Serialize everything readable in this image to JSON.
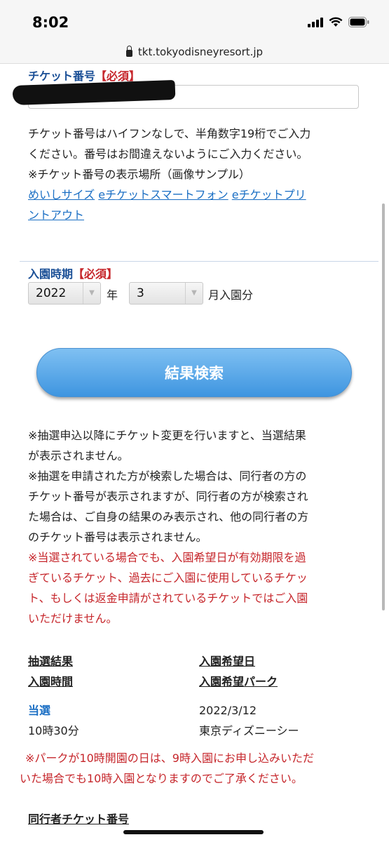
{
  "status": {
    "time": "8:02"
  },
  "browser": {
    "url": "tkt.tokyodisneyresort.jp"
  },
  "ticket": {
    "label": "チケット番号",
    "required": "【必須】",
    "help_lines": [
      "チケット番号はハイフンなしで、半角数字19桁でご入力",
      "ください。番号はお間違えないようにご入力ください。",
      "※チケット番号の表示場所（画像サンプル）"
    ],
    "links": [
      "めいしサイズ",
      "eチケットスマートフォン",
      "eチケットプリ",
      "ントアウト"
    ]
  },
  "entry": {
    "label": "入園時期",
    "required": "【必須】",
    "year": "2022",
    "year_unit": "年",
    "month": "3",
    "month_unit": "月入園分"
  },
  "search_button": "結果検索",
  "notes": [
    "※抽選申込以降にチケット変更を行いますと、当選結果",
    "が表示されません。",
    "※抽選を申請された方が検索した場合は、同行者の方の",
    "チケット番号が表示されますが、同行者の方が検索され",
    "た場合は、ご自身の結果のみ表示され、他の同行者の方",
    "のチケット番号は表示されません。"
  ],
  "red_notes": [
    "※当選されている場合でも、入園希望日が有効期限を過",
    "ぎているチケット、過去にご入園に使用しているチケッ",
    "ト、もしくは返金申請がされているチケットではご入園",
    "いただけません。"
  ],
  "results": {
    "headers": [
      "抽選結果",
      "入園時間",
      "入園希望日",
      "入園希望パーク"
    ],
    "result": "当選",
    "time": "10時30分",
    "date": "2022/3/12",
    "park": "東京ディズニーシー"
  },
  "park_note": [
    "※パークが10時開園の日は、9時入園にお申し込みいただ",
    "いた場合でも10時入園となりますのでご了承ください。"
  ],
  "companion": {
    "label": "同行者チケット番号"
  },
  "colors": {
    "label": "#1a4f96",
    "required": "#c6262b",
    "link": "#1b6fc4",
    "button": "#4a9ee6"
  }
}
